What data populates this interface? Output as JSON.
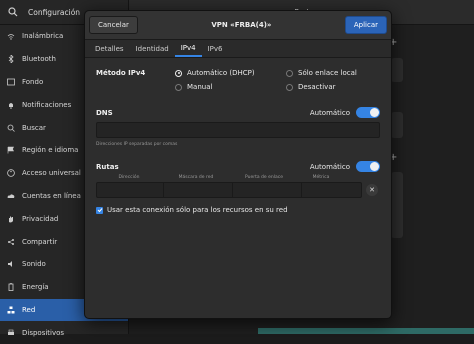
{
  "app": {
    "title": "Configuración",
    "section_title": "Red"
  },
  "sidebar": {
    "items": [
      {
        "label": "Inalámbrica",
        "icon": "wifi-icon"
      },
      {
        "label": "Bluetooth",
        "icon": "bluetooth-icon"
      },
      {
        "label": "Fondo",
        "icon": "background-icon"
      },
      {
        "label": "Notificaciones",
        "icon": "bell-icon"
      },
      {
        "label": "Buscar",
        "icon": "search-icon"
      },
      {
        "label": "Región e idioma",
        "icon": "flag-icon"
      },
      {
        "label": "Acceso universal",
        "icon": "accessibility-icon"
      },
      {
        "label": "Cuentas en línea",
        "icon": "cloud-icon"
      },
      {
        "label": "Privacidad",
        "icon": "hand-icon"
      },
      {
        "label": "Compartir",
        "icon": "share-icon"
      },
      {
        "label": "Sonido",
        "icon": "speaker-icon"
      },
      {
        "label": "Energía",
        "icon": "battery-icon"
      },
      {
        "label": "Red",
        "icon": "network-icon",
        "active": true
      },
      {
        "label": "Dispositivos",
        "icon": "printer-icon"
      }
    ]
  },
  "dialog": {
    "title": "VPN «FRBA(4)»",
    "cancel_label": "Cancelar",
    "apply_label": "Aplicar",
    "tabs": [
      "Detalles",
      "Identidad",
      "IPv4",
      "IPv6"
    ],
    "active_tab": "IPv4",
    "ipv4_method": {
      "label": "Método IPv4",
      "options": [
        "Automático (DHCP)",
        "Sólo enlace local",
        "Manual",
        "Desactivar"
      ],
      "selected": "Automático (DHCP)"
    },
    "dns": {
      "label": "DNS",
      "auto_label": "Automático",
      "auto_on": true,
      "value": "",
      "hint": "Direcciones IP separadas por comas"
    },
    "routes": {
      "label": "Rutas",
      "auto_label": "Automático",
      "auto_on": true,
      "columns": [
        "Dirección",
        "Máscara de red",
        "Puerta de enlace",
        "Métrica"
      ]
    },
    "only_resources_label": "Usar esta conexión sólo para los recursos en su red",
    "only_resources_checked": true
  },
  "colors": {
    "accent": "#3584e4",
    "apply": "#2b64b8",
    "active_sidebar": "#2a5fa8"
  }
}
